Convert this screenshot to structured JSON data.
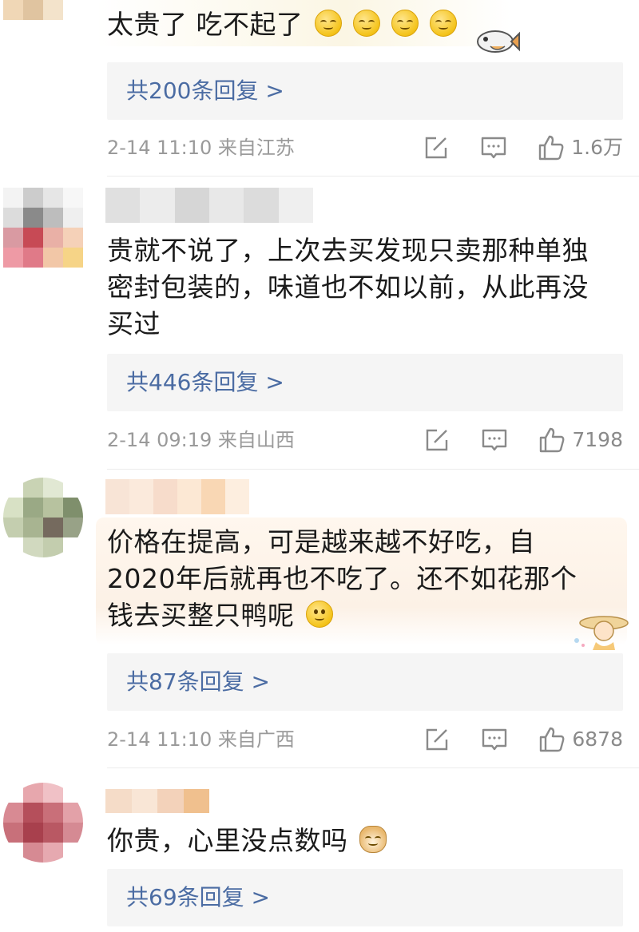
{
  "comments": [
    {
      "text": "太贵了 吃不起了",
      "replies_label": "共200条回复 >",
      "time_location": "2-14 11:10 来自江苏",
      "likes": "1.6万",
      "emoji": [
        "eye-roll-emoji",
        "eye-roll-emoji",
        "eye-roll-emoji",
        "eye-roll-emoji"
      ]
    },
    {
      "text": "贵就不说了，上次去买发现只卖那种单独密封包装的，味道也不如以前，从此再没买过",
      "replies_label": "共446条回复 >",
      "time_location": "2-14 09:19 来自山西",
      "likes": "7198"
    },
    {
      "text": "价格在提高，可是越来越不好吃，自2020年后就再也不吃了。还不如花那个钱去买整只鸭呢",
      "replies_label": "共87条回复 >",
      "time_location": "2-14 11:10 来自广西",
      "likes": "6878",
      "emoji": [
        "smile-emoji"
      ]
    },
    {
      "text": "你贵，心里没点数吗",
      "replies_label": "共69条回复 >",
      "emoji": [
        "doge-emoji"
      ]
    }
  ],
  "colors": {
    "reply_link": "#4b6ca3",
    "meta_text": "#9a9a9a",
    "reply_box_bg": "#f5f5f5"
  },
  "icons": [
    "edit-share-icon",
    "comment-icon",
    "thumbs-up-icon"
  ]
}
